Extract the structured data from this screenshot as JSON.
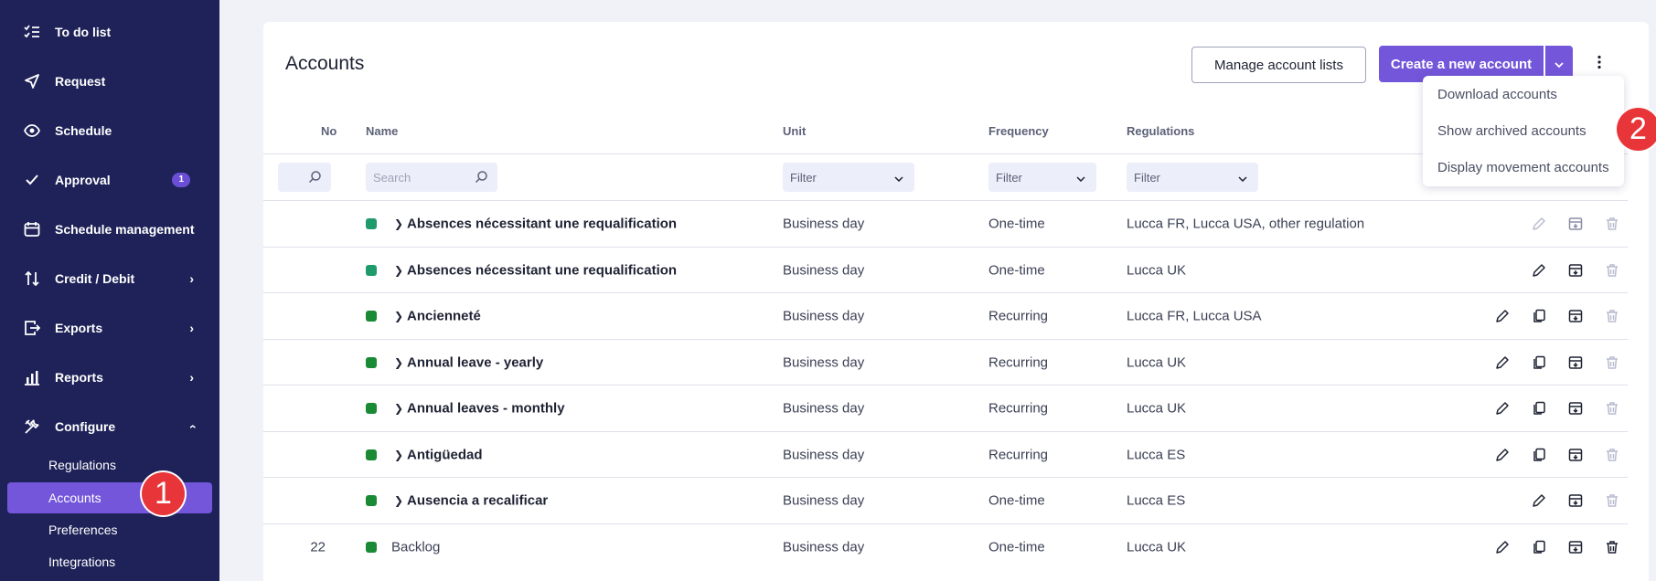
{
  "sidebar": {
    "items": [
      {
        "label": "To do list",
        "icon": "checklist-icon"
      },
      {
        "label": "Request",
        "icon": "send-icon"
      },
      {
        "label": "Schedule",
        "icon": "eye-icon"
      },
      {
        "label": "Approval",
        "icon": "check-icon",
        "badge": "1"
      },
      {
        "label": "Schedule management",
        "icon": "calendar-icon"
      },
      {
        "label": "Credit / Debit",
        "icon": "arrows-updown-icon"
      },
      {
        "label": "Exports",
        "icon": "export-icon"
      },
      {
        "label": "Reports",
        "icon": "bar-chart-icon"
      },
      {
        "label": "Configure",
        "icon": "tools-icon"
      }
    ],
    "sub_items": [
      "Regulations",
      "Accounts",
      "Preferences",
      "Integrations"
    ],
    "active_sub": "Accounts"
  },
  "markers": {
    "m1": "1",
    "m2": "2"
  },
  "header": {
    "title": "Accounts",
    "manage_label": "Manage account lists",
    "create_label": "Create a new account"
  },
  "dropdown": {
    "items": [
      "Download accounts",
      "Show archived accounts",
      "Display movement accounts"
    ]
  },
  "table": {
    "columns": {
      "no": "No",
      "name": "Name",
      "unit": "Unit",
      "frequency": "Frequency",
      "regulations": "Regulations"
    },
    "search_placeholder": "Search",
    "filter_label": "Filter",
    "rows": [
      {
        "no": "",
        "name": "Absences nécessitant une requalification",
        "expandable": true,
        "unit": "Business day",
        "frequency": "One-time",
        "regulations": "Lucca FR, Lucca USA, other regulation"
      },
      {
        "no": "",
        "name": "Absences nécessitant une requalification",
        "expandable": true,
        "unit": "Business day",
        "frequency": "One-time",
        "regulations": "Lucca UK"
      },
      {
        "no": "",
        "name": "Ancienneté",
        "expandable": true,
        "unit": "Business day",
        "frequency": "Recurring",
        "regulations": "Lucca FR, Lucca USA"
      },
      {
        "no": "",
        "name": "Annual leave - yearly",
        "expandable": true,
        "unit": "Business day",
        "frequency": "Recurring",
        "regulations": "Lucca UK"
      },
      {
        "no": "",
        "name": "Annual leaves - monthly",
        "expandable": true,
        "unit": "Business day",
        "frequency": "Recurring",
        "regulations": "Lucca UK"
      },
      {
        "no": "",
        "name": "Antigüedad",
        "expandable": true,
        "unit": "Business day",
        "frequency": "Recurring",
        "regulations": "Lucca ES"
      },
      {
        "no": "",
        "name": "Ausencia a recalificar",
        "expandable": true,
        "unit": "Business day",
        "frequency": "One-time",
        "regulations": "Lucca ES"
      },
      {
        "no": "22",
        "name": "Backlog",
        "expandable": false,
        "unit": "Business day",
        "frequency": "One-time",
        "regulations": "Lucca UK"
      }
    ]
  },
  "colors": {
    "sidebar_bg": "#1e2258",
    "accent": "#7356d9",
    "marker": "#e8353a",
    "status_green": "#1a8a35"
  }
}
